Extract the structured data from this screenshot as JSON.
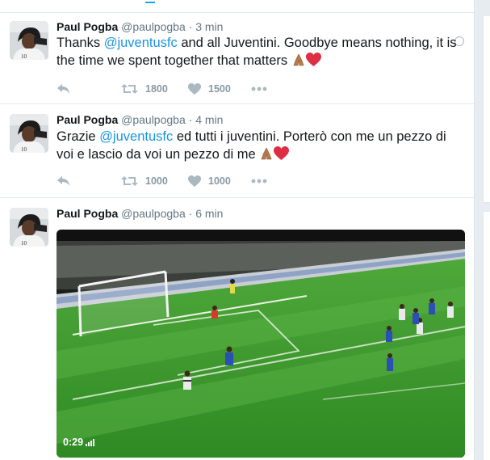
{
  "tweets": [
    {
      "name": "Paul Pogba",
      "handle": "@paulpogba",
      "sep": "·",
      "time": "3 min",
      "text_before": "Thanks ",
      "mention": "@juventusfc",
      "text_after": " and all Juventini. Goodbye means nothing, it is the time we spent together that matters",
      "retweets": "1800",
      "likes": "1500"
    },
    {
      "name": "Paul Pogba",
      "handle": "@paulpogba",
      "sep": "·",
      "time": "4 min",
      "text_before": "Grazie ",
      "mention": "@juventusfc",
      "text_after": " ed tutti i juventini. Porterò con me un pezzo di voi e lascio da voi un pezzo di me",
      "retweets": "1000",
      "likes": "1000"
    },
    {
      "name": "Paul Pogba",
      "handle": "@paulpogba",
      "sep": "·",
      "time": "6 min",
      "video_duration": "0:29"
    }
  ],
  "icons": {
    "reply": "reply-icon",
    "retweet": "retweet-icon",
    "like": "heart-icon",
    "more": "more-icon",
    "globe": "globe-icon",
    "emoji_pray": "folded-hands-emoji",
    "emoji_heart": "red-heart-emoji"
  },
  "colors": {
    "mention": "#1b95e0",
    "name": "#14171a",
    "meta": "#657786",
    "action": "#aab8c2",
    "heart": "#e0245e",
    "pitch": "#3f9a2c"
  }
}
